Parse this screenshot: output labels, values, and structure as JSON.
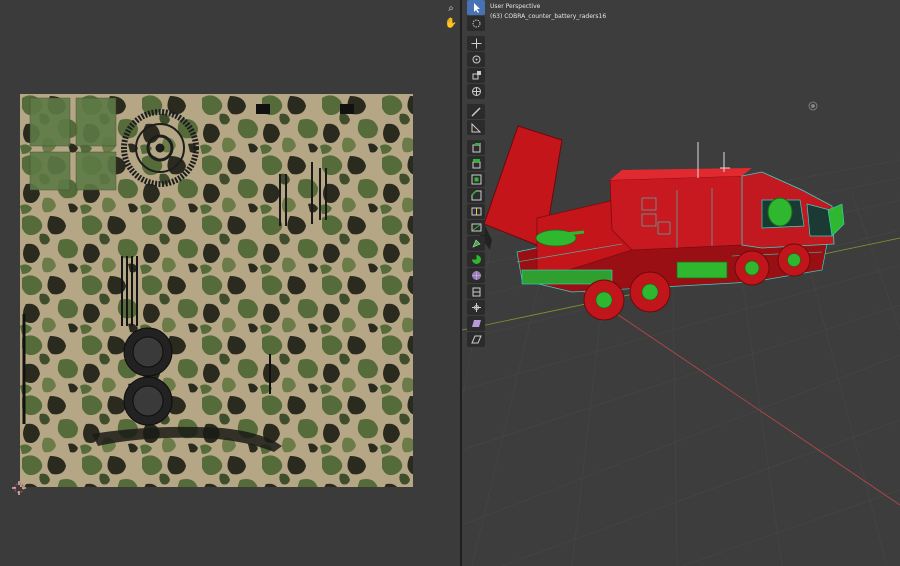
{
  "viewport": {
    "perspective_label": "User Perspective",
    "object_label": "(63) COBRA_counter_battery_raders16"
  },
  "uv_nav": [
    {
      "name": "zoom-icon",
      "glyph": "⌕"
    },
    {
      "name": "hand-icon",
      "glyph": "✋"
    }
  ],
  "toolbar": {
    "active_tool": "select-box-tool",
    "tools": [
      "select-box-tool",
      "cursor-tool",
      "move-tool",
      "rotate-tool",
      "scale-tool",
      "transform-tool",
      "annotate-tool",
      "measure-tool",
      "add-cube-tool",
      "extrude-region-tool",
      "inset-faces-tool",
      "bevel-tool",
      "loop-cut-tool",
      "knife-tool",
      "poly-build-tool",
      "spin-tool",
      "smooth-tool",
      "edge-slide-tool",
      "shrink-fatten-tool",
      "shear-tool",
      "rip-region-tool"
    ]
  },
  "colors": {
    "uv_background": "#3b3b3b",
    "viewport_background": "#3d3d3d",
    "camo_base": "#b5a785",
    "camo_green": "#556b3a",
    "camo_dark": "#2a2a1f",
    "mesh_red": "#c0151a",
    "mesh_green": "#2fb82f",
    "wire_cyan": "#38d3c7",
    "active_tool": "#4772b3",
    "x_axis": "#c0464e",
    "y_axis": "#7f9b2f"
  }
}
